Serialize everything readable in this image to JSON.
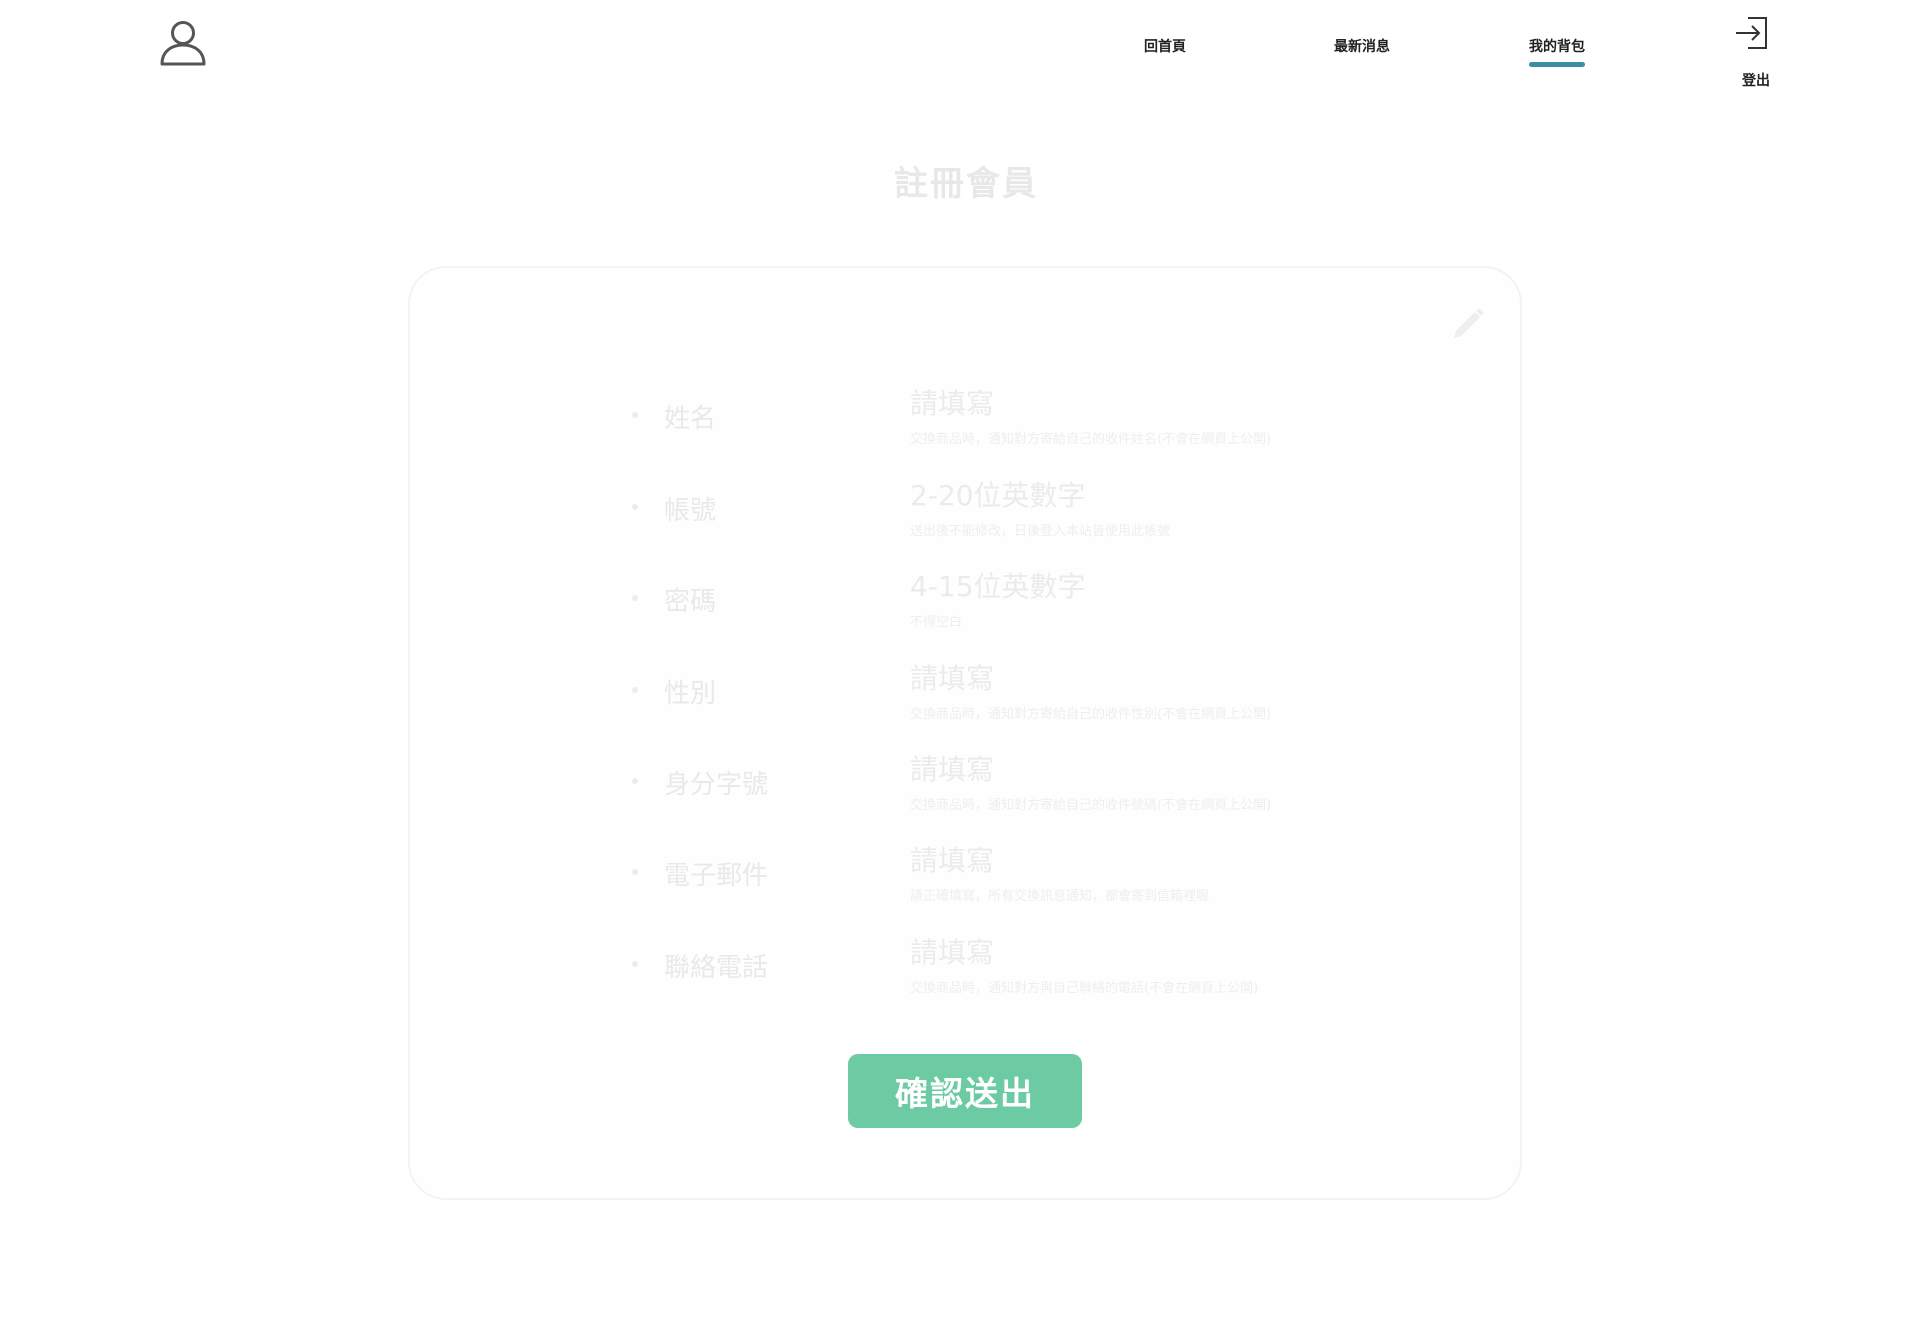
{
  "header": {
    "nav": [
      {
        "label": "回首頁",
        "active": false
      },
      {
        "label": "最新消息",
        "active": false
      },
      {
        "label": "我的背包",
        "active": true
      }
    ],
    "logout_label": "登出",
    "active_color": "#3a8ea0",
    "icons": {
      "user": "user-icon",
      "logout": "login-arrow-icon"
    }
  },
  "form": {
    "title": "註冊會員",
    "edit_icon": "pencil-icon",
    "fields": [
      {
        "label": "姓名",
        "placeholder": "請填寫",
        "hint": "交換商品時，通知對方寄給自己的收件姓名(不會在網頁上公開)"
      },
      {
        "label": "帳號",
        "placeholder": "2-20位英數字",
        "hint": "送出後不能修改，日後登入本站皆使用此帳號"
      },
      {
        "label": "密碼",
        "placeholder": "4-15位英數字",
        "hint": "不得空白"
      },
      {
        "label": "性別",
        "placeholder": "請填寫",
        "hint": "交換商品時，通知對方寄給自己的收件性別(不會在網頁上公開)"
      },
      {
        "label": "身分字號",
        "placeholder": "請填寫",
        "hint": "交換商品時，通知對方寄給自己的收件號碼(不會在網頁上公開)"
      },
      {
        "label": "電子郵件",
        "placeholder": "請填寫",
        "hint": "請正確填寫，所有交換訊息通知，都會寄到信箱裡喔"
      },
      {
        "label": "聯絡電話",
        "placeholder": "請填寫",
        "hint": "交換商品時，通知對方與自己聯絡的電話(不會在網頁上公開)"
      }
    ],
    "submit_label": "確認送出",
    "submit_color": "#6ccba2"
  }
}
